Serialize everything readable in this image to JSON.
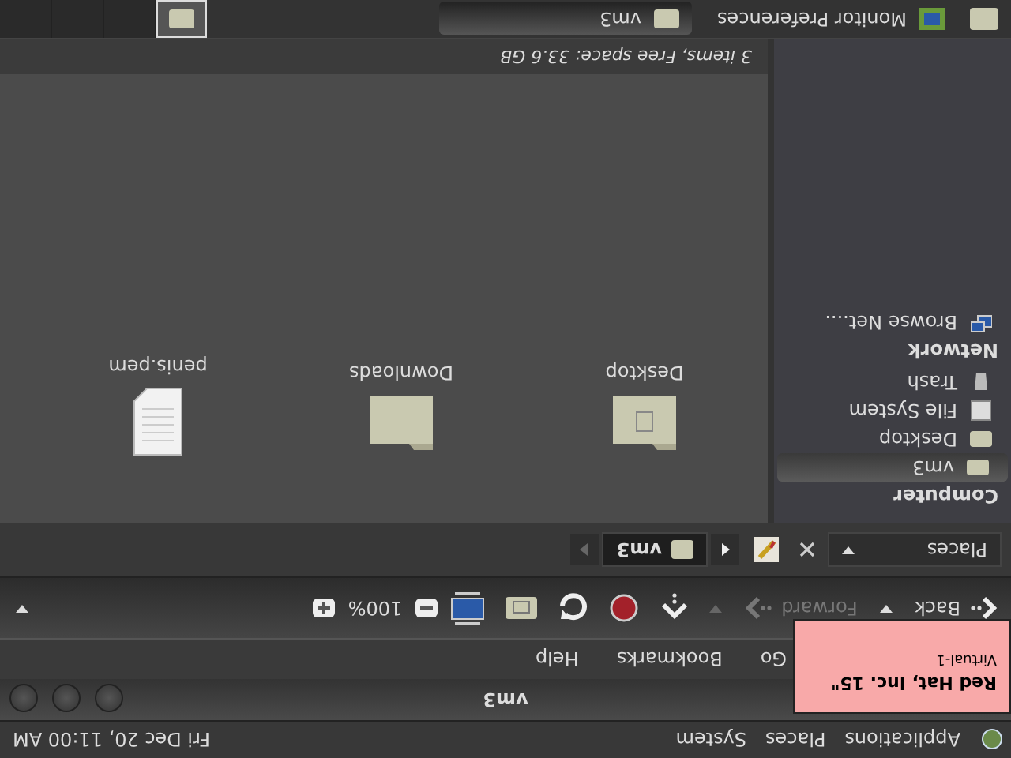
{
  "top_panel": {
    "menus": [
      "Applications",
      "Places",
      "System"
    ],
    "clock": "Fri Dec 20, 11:00 AM"
  },
  "popup": {
    "title": "Red Hat, Inc. 15\"",
    "subtitle": "Virtual-1"
  },
  "window": {
    "title": "vm3",
    "menu": [
      "Go",
      "Bookmarks",
      "Help"
    ]
  },
  "toolbar": {
    "back": {
      "label": "Back",
      "disabled": false
    },
    "forward": {
      "label": "Forward",
      "disabled": true
    },
    "zoom": "100%"
  },
  "location": {
    "places_label": "Places",
    "path": [
      {
        "label": "vm3",
        "selected": true
      }
    ]
  },
  "sidebar": [
    {
      "heading": "Computer",
      "items": [
        {
          "label": "vm3",
          "kind": "home",
          "selected": true
        },
        {
          "label": "Desktop",
          "kind": "desktop",
          "selected": false
        },
        {
          "label": "File System",
          "kind": "drive",
          "selected": false
        },
        {
          "label": "Trash",
          "kind": "trash",
          "selected": false
        }
      ]
    },
    {
      "heading": "Network",
      "items": [
        {
          "label": "Browse Net....",
          "kind": "network",
          "selected": false
        }
      ]
    }
  ],
  "files": [
    {
      "name": "Desktop",
      "kind": "desktop"
    },
    {
      "name": "Downloads",
      "kind": "folder"
    },
    {
      "name": "penis.pem",
      "kind": "file"
    }
  ],
  "status_bar": "3 items, Free space: 33.6 GB",
  "taskbar": {
    "tasks": [
      {
        "label": "Monitor Preferences",
        "kind": "monitor",
        "selected": false
      },
      {
        "label": "vm3",
        "kind": "home",
        "selected": true
      }
    ],
    "workspaces": [
      {
        "selected": true
      },
      {
        "selected": false
      },
      {
        "selected": false
      },
      {
        "selected": false
      }
    ]
  }
}
